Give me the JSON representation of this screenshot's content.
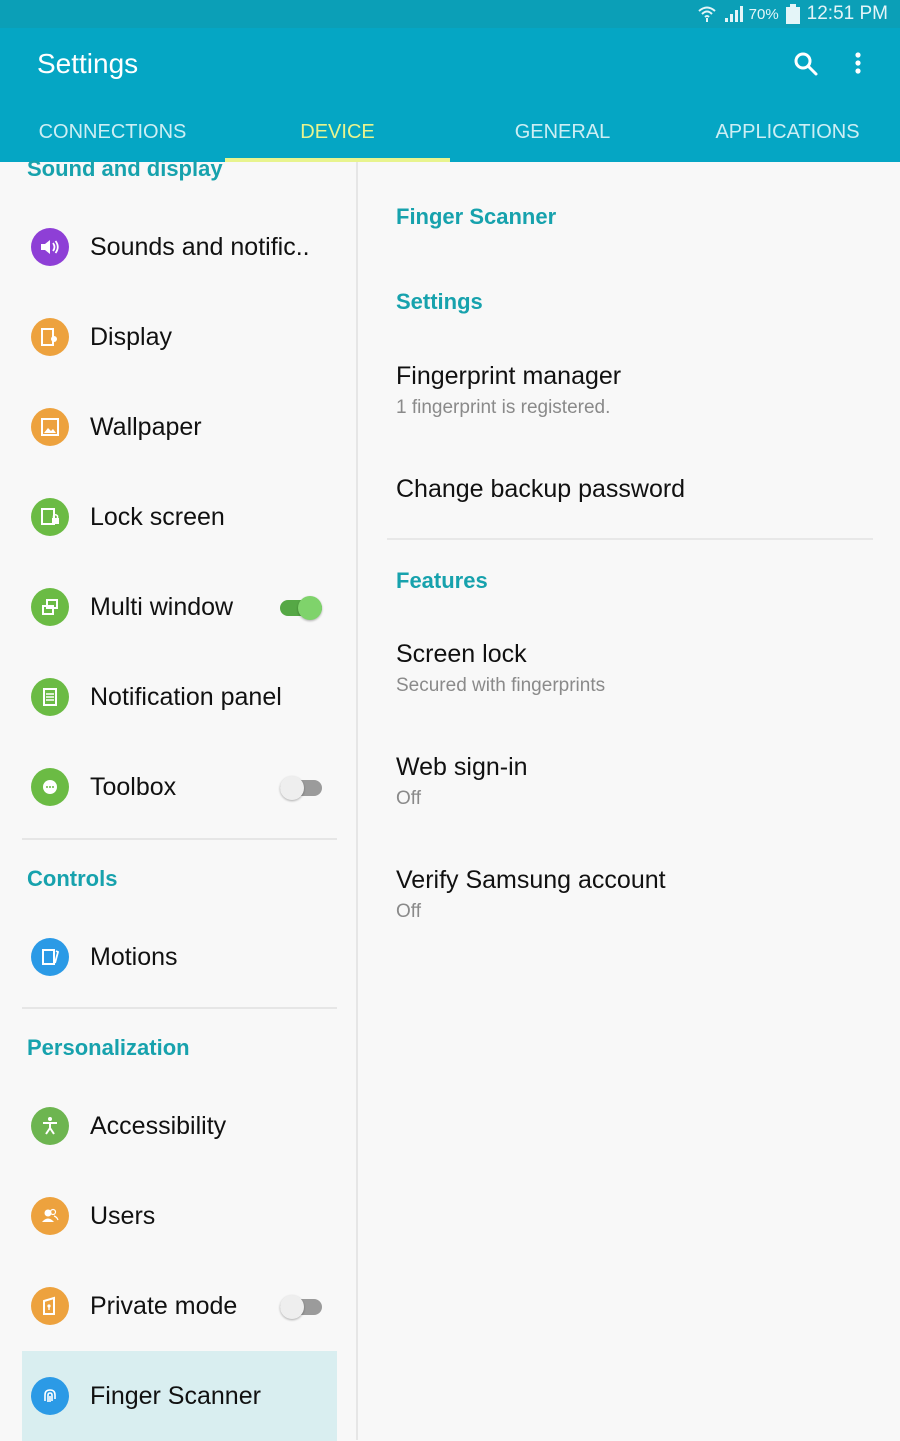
{
  "status_bar": {
    "wifi_icon": "wifi-icon",
    "signal_icon": "signal-icon",
    "battery_percent": "70%",
    "battery_icon": "battery-icon",
    "time": "12:51 PM"
  },
  "app_bar": {
    "title": "Settings",
    "search_icon": "search-icon",
    "more_icon": "more-vert-icon"
  },
  "tabs": [
    {
      "label": "CONNECTIONS",
      "active": false
    },
    {
      "label": "DEVICE",
      "active": true
    },
    {
      "label": "GENERAL",
      "active": false
    },
    {
      "label": "APPLICATIONS",
      "active": false
    }
  ],
  "colors": {
    "app_bar": "#05a6c4",
    "active_tab": "#e8f48e",
    "section_header": "#17a2ad",
    "selected_row": "#d9eef0",
    "toggle_on": "#55a845"
  },
  "left_panel": {
    "sections": [
      {
        "header": "Sound and display",
        "items": [
          {
            "label": "Sounds and notific..",
            "icon": "volume-icon",
            "icon_color": "#8e3fd6"
          },
          {
            "label": "Display",
            "icon": "display-icon",
            "icon_color": "#eda23e"
          },
          {
            "label": "Wallpaper",
            "icon": "wallpaper-icon",
            "icon_color": "#eda23e"
          },
          {
            "label": "Lock screen",
            "icon": "lock-screen-icon",
            "icon_color": "#6bbb44"
          },
          {
            "label": "Multi window",
            "icon": "multi-window-icon",
            "icon_color": "#6bbb44",
            "toggle": true
          },
          {
            "label": "Notification panel",
            "icon": "notification-panel-icon",
            "icon_color": "#6bbb44"
          },
          {
            "label": "Toolbox",
            "icon": "toolbox-icon",
            "icon_color": "#6bbb44",
            "toggle": false
          }
        ]
      },
      {
        "header": "Controls",
        "items": [
          {
            "label": "Motions",
            "icon": "motions-icon",
            "icon_color": "#2b9ae6"
          }
        ]
      },
      {
        "header": "Personalization",
        "items": [
          {
            "label": "Accessibility",
            "icon": "accessibility-icon",
            "icon_color": "#6db550"
          },
          {
            "label": "Users",
            "icon": "users-icon",
            "icon_color": "#eda23e"
          },
          {
            "label": "Private mode",
            "icon": "private-mode-icon",
            "icon_color": "#eda23e",
            "toggle": false
          },
          {
            "label": "Finger Scanner",
            "icon": "fingerprint-icon",
            "icon_color": "#2b9ae6",
            "selected": true
          }
        ]
      }
    ]
  },
  "right_panel": {
    "title": "Finger Scanner",
    "settings_header": "Settings",
    "settings_items": [
      {
        "title": "Fingerprint manager",
        "subtitle": "1 fingerprint is registered."
      },
      {
        "title": "Change backup password"
      }
    ],
    "features_header": "Features",
    "features_items": [
      {
        "title": "Screen lock",
        "subtitle": "Secured with fingerprints"
      },
      {
        "title": "Web sign-in",
        "subtitle": "Off"
      },
      {
        "title": "Verify Samsung account",
        "subtitle": "Off"
      }
    ]
  }
}
